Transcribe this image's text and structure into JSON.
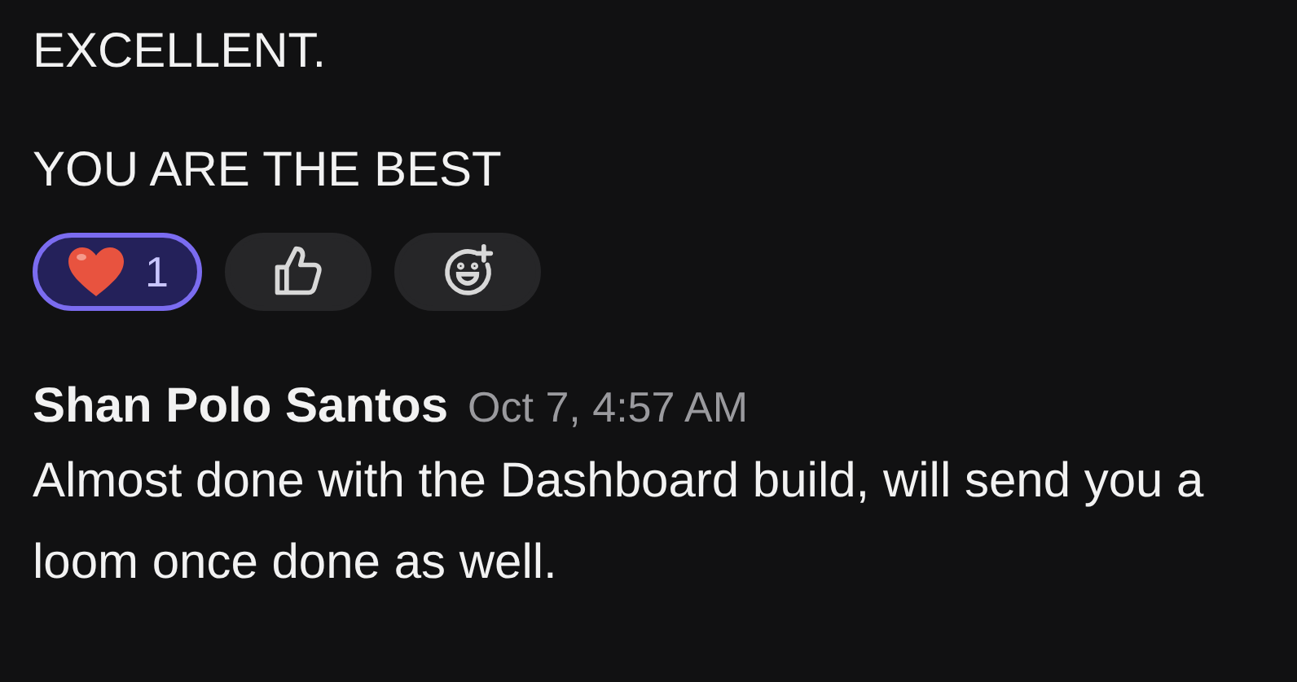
{
  "lines": [
    "EXCELLENT.",
    "YOU ARE THE BEST"
  ],
  "reactions": [
    {
      "kind": "heart",
      "count": "1",
      "selected": true
    },
    {
      "kind": "thumbs-up",
      "selected": false
    },
    {
      "kind": "add-reaction",
      "selected": false
    }
  ],
  "message": {
    "author": "Shan Polo Santos",
    "time": "Oct 7, 4:57 AM",
    "text": "Almost done with the Dashboard build, will send you a loom once done as well."
  }
}
